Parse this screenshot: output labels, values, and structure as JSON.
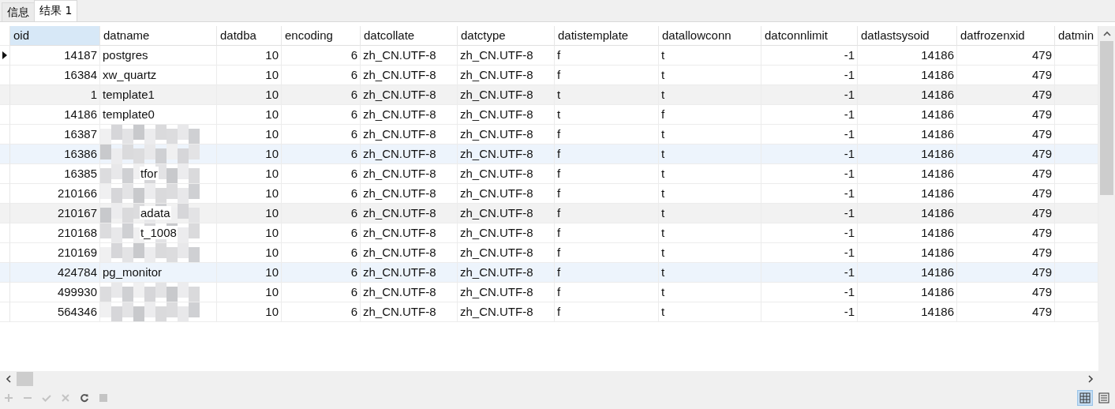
{
  "tabs": [
    {
      "label": "信息",
      "selected": false
    },
    {
      "label": "结果 1",
      "selected": true
    }
  ],
  "table": {
    "columns": [
      {
        "label": "oid",
        "kind": "number",
        "selected": true
      },
      {
        "label": "datname",
        "kind": "text",
        "selected": false
      },
      {
        "label": "datdba",
        "kind": "number",
        "selected": false
      },
      {
        "label": "encoding",
        "kind": "number",
        "selected": false
      },
      {
        "label": "datcollate",
        "kind": "text",
        "selected": false
      },
      {
        "label": "datctype",
        "kind": "text",
        "selected": false
      },
      {
        "label": "datistemplate",
        "kind": "text",
        "selected": false
      },
      {
        "label": "datallowconn",
        "kind": "text",
        "selected": false
      },
      {
        "label": "datconnlimit",
        "kind": "number",
        "selected": false
      },
      {
        "label": "datlastsysoid",
        "kind": "number",
        "selected": false
      },
      {
        "label": "datfrozenxid",
        "kind": "number",
        "selected": false
      },
      {
        "label": "datmin",
        "selected": false
      }
    ],
    "rows": [
      {
        "current": true,
        "alternate": false,
        "hovered": false,
        "redacted": false,
        "cells": [
          "14187",
          "postgres",
          "10",
          "6",
          "zh_CN.UTF-8",
          "zh_CN.UTF-8",
          "f",
          "t",
          "-1",
          "14186",
          "479"
        ]
      },
      {
        "current": false,
        "alternate": false,
        "hovered": false,
        "redacted": false,
        "cells": [
          "16384",
          "xw_quartz",
          "10",
          "6",
          "zh_CN.UTF-8",
          "zh_CN.UTF-8",
          "f",
          "t",
          "-1",
          "14186",
          "479"
        ]
      },
      {
        "current": false,
        "alternate": true,
        "hovered": false,
        "redacted": false,
        "cells": [
          "1",
          "template1",
          "10",
          "6",
          "zh_CN.UTF-8",
          "zh_CN.UTF-8",
          "t",
          "t",
          "-1",
          "14186",
          "479"
        ]
      },
      {
        "current": false,
        "alternate": false,
        "hovered": false,
        "redacted": false,
        "cells": [
          "14186",
          "template0",
          "10",
          "6",
          "zh_CN.UTF-8",
          "zh_CN.UTF-8",
          "t",
          "f",
          "-1",
          "14186",
          "479"
        ]
      },
      {
        "current": false,
        "alternate": false,
        "hovered": false,
        "redacted": true,
        "cells": [
          "16387",
          null,
          "10",
          "6",
          "zh_CN.UTF-8",
          "zh_CN.UTF-8",
          "f",
          "t",
          "-1",
          "14186",
          "479"
        ]
      },
      {
        "current": false,
        "alternate": false,
        "hovered": true,
        "redacted": true,
        "cells": [
          "16386",
          null,
          "10",
          "6",
          "zh_CN.UTF-8",
          "zh_CN.UTF-8",
          "f",
          "t",
          "-1",
          "14186",
          "479"
        ]
      },
      {
        "current": false,
        "alternate": false,
        "hovered": false,
        "redacted": true,
        "cells": [
          "16385",
          "tfor",
          "10",
          "6",
          "zh_CN.UTF-8",
          "zh_CN.UTF-8",
          "f",
          "t",
          "-1",
          "14186",
          "479"
        ]
      },
      {
        "current": false,
        "alternate": false,
        "hovered": false,
        "redacted": true,
        "cells": [
          "210166",
          null,
          "10",
          "6",
          "zh_CN.UTF-8",
          "zh_CN.UTF-8",
          "f",
          "t",
          "-1",
          "14186",
          "479"
        ]
      },
      {
        "current": false,
        "alternate": true,
        "hovered": false,
        "redacted": true,
        "cells": [
          "210167",
          "adata",
          "10",
          "6",
          "zh_CN.UTF-8",
          "zh_CN.UTF-8",
          "f",
          "t",
          "-1",
          "14186",
          "479"
        ]
      },
      {
        "current": false,
        "alternate": false,
        "hovered": false,
        "redacted": true,
        "cells": [
          "210168",
          "t_1008",
          "10",
          "6",
          "zh_CN.UTF-8",
          "zh_CN.UTF-8",
          "f",
          "t",
          "-1",
          "14186",
          "479"
        ]
      },
      {
        "current": false,
        "alternate": false,
        "hovered": false,
        "redacted": true,
        "cells": [
          "210169",
          null,
          "10",
          "6",
          "zh_CN.UTF-8",
          "zh_CN.UTF-8",
          "f",
          "t",
          "-1",
          "14186",
          "479"
        ]
      },
      {
        "current": false,
        "alternate": false,
        "hovered": true,
        "redacted": false,
        "cells": [
          "424784",
          "pg_monitor",
          "10",
          "6",
          "zh_CN.UTF-8",
          "zh_CN.UTF-8",
          "f",
          "t",
          "-1",
          "14186",
          "479"
        ]
      },
      {
        "current": false,
        "alternate": false,
        "hovered": false,
        "redacted": true,
        "cells": [
          "499930",
          null,
          "10",
          "6",
          "zh_CN.UTF-8",
          "zh_CN.UTF-8",
          "f",
          "t",
          "-1",
          "14186",
          "479"
        ]
      },
      {
        "current": false,
        "alternate": false,
        "hovered": false,
        "redacted": true,
        "cells": [
          "564346",
          null,
          "10",
          "6",
          "zh_CN.UTF-8",
          "zh_CN.UTF-8",
          "f",
          "t",
          "-1",
          "14186",
          "479"
        ]
      }
    ]
  },
  "toolbar": [
    {
      "kind": "add",
      "disabled": true
    },
    {
      "kind": "remove",
      "disabled": true
    },
    {
      "kind": "apply",
      "disabled": true
    },
    {
      "kind": "discard",
      "disabled": true
    },
    {
      "kind": "refresh",
      "disabled": false
    },
    {
      "kind": "stop",
      "disabled": true
    }
  ],
  "view_modes": [
    {
      "kind": "grid",
      "selected": true
    },
    {
      "kind": "form",
      "selected": false
    }
  ]
}
